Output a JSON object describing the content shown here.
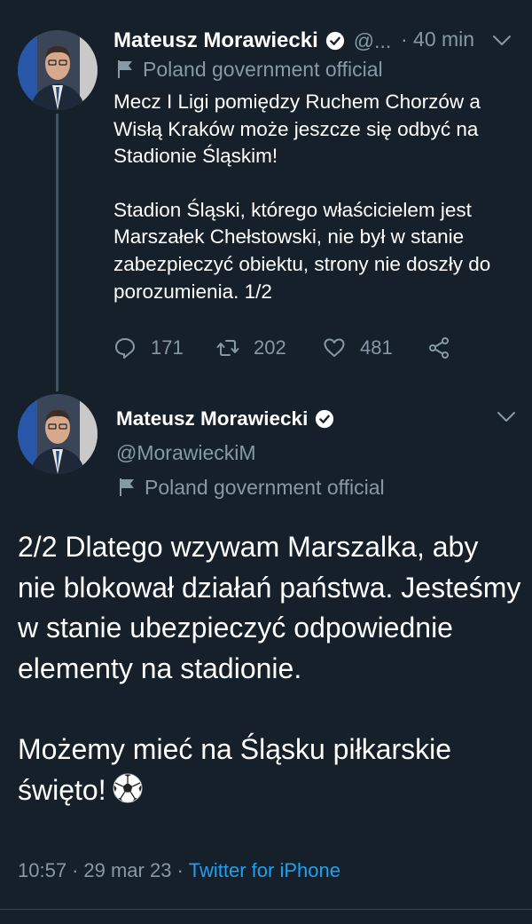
{
  "colors": {
    "background": "#15202b",
    "text_primary": "#ffffff",
    "text_secondary": "#8899a6",
    "link": "#1da1f2",
    "thread_line": "#3d5466"
  },
  "tweet1": {
    "name": "Mateusz Morawiecki",
    "handle_truncated": "@...",
    "time": "· 40 min",
    "label": "Poland government official",
    "paragraphs": [
      "Mecz I Ligi pomiędzy Ruchem Chorzów a Wisłą Kraków może jeszcze się odbyć na Stadionie Śląskim!",
      "Stadion Śląski, którego właścicielem jest Marszałek Chełstowski, nie był w stanie zabezpieczyć obiektu, strony nie doszły do porozumienia. 1/2"
    ],
    "actions": {
      "replies": "171",
      "retweets": "202",
      "likes": "481"
    },
    "icons": [
      "verified-icon",
      "chevron-down-icon",
      "flag-icon",
      "reply-icon",
      "retweet-icon",
      "like-icon",
      "share-icon"
    ]
  },
  "tweet2": {
    "name": "Mateusz Morawiecki",
    "handle": "@MorawieckiM",
    "label": "Poland government official",
    "paragraphs": [
      "2/2 Dlatego wzywam Marszalka, aby nie blokował działań państwa. Jesteśmy w stanie ubezpieczyć odpowiednie elementy na stadionie.",
      "Możemy mieć na Śląsku piłkarskie święto!"
    ],
    "emoji": "soccer-ball",
    "time": "10:57",
    "date": "29 mar 23",
    "separator": "·",
    "source": "Twitter for iPhone"
  }
}
